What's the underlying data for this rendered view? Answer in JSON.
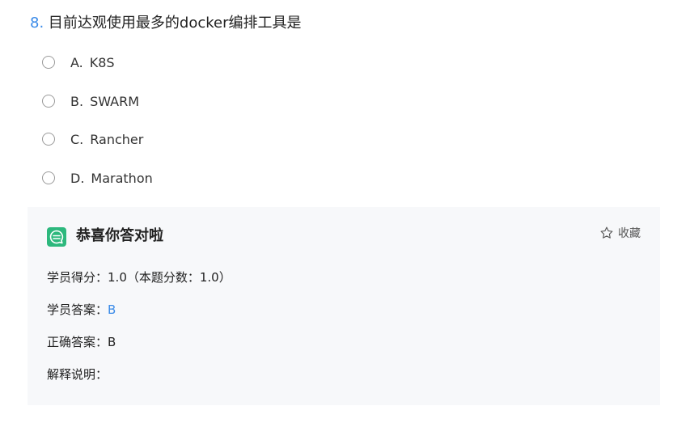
{
  "question": {
    "number": "8.",
    "text": "目前达观使用最多的docker编排工具是"
  },
  "options": [
    {
      "letter": "A.",
      "text": "K8S"
    },
    {
      "letter": "B.",
      "text": "SWARM"
    },
    {
      "letter": "C.",
      "text": "Rancher"
    },
    {
      "letter": "D.",
      "text": "Marathon"
    }
  ],
  "result": {
    "title": "恭喜你答对啦",
    "icon": "chat-bubble-icon",
    "favorite_label": "收藏",
    "favorite_icon": "star-outline-icon",
    "score_label": "学员得分：",
    "score_value": "1.0（本题分数：1.0）",
    "student_answer_label": "学员答案：",
    "student_answer_value": "B",
    "correct_answer_label": "正确答案：",
    "correct_answer_value": "B",
    "explanation_label": "解释说明："
  },
  "colors": {
    "accent": "#3b8be8",
    "success": "#2db87d",
    "panel_bg": "#f7f8fa"
  }
}
